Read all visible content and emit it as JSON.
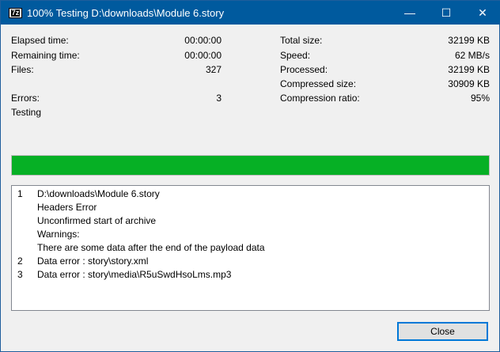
{
  "window": {
    "title": "100% Testing D:\\downloads\\Module 6.story",
    "logo": "7z",
    "minimize": "—",
    "maximize": "☐",
    "close": "✕"
  },
  "stats_left": [
    {
      "label": "Elapsed time:",
      "value": "00:00:00"
    },
    {
      "label": "Remaining time:",
      "value": "00:00:00"
    },
    {
      "label": "Files:",
      "value": "327"
    },
    {
      "label": "Errors:",
      "value": "3"
    }
  ],
  "stats_right": [
    {
      "label": "Total size:",
      "value": "32199 KB"
    },
    {
      "label": "Speed:",
      "value": "62 MB/s"
    },
    {
      "label": "Processed:",
      "value": "32199 KB"
    },
    {
      "label": "Compressed size:",
      "value": "30909 KB"
    },
    {
      "label": "Compression ratio:",
      "value": "95%"
    }
  ],
  "status": "Testing",
  "progress_percent": 100,
  "messages": [
    {
      "n": "1",
      "text": "D:\\downloads\\Module 6.story"
    },
    {
      "n": "",
      "text": "Headers Error"
    },
    {
      "n": "",
      "text": "Unconfirmed start of archive"
    },
    {
      "n": "",
      "text": "Warnings:"
    },
    {
      "n": "",
      "text": "There are some data after the end of the payload data"
    },
    {
      "n": "2",
      "text": "Data error : story\\story.xml"
    },
    {
      "n": "3",
      "text": "Data error : story\\media\\R5uSwdHsoLms.mp3"
    }
  ],
  "close_label": "Close"
}
